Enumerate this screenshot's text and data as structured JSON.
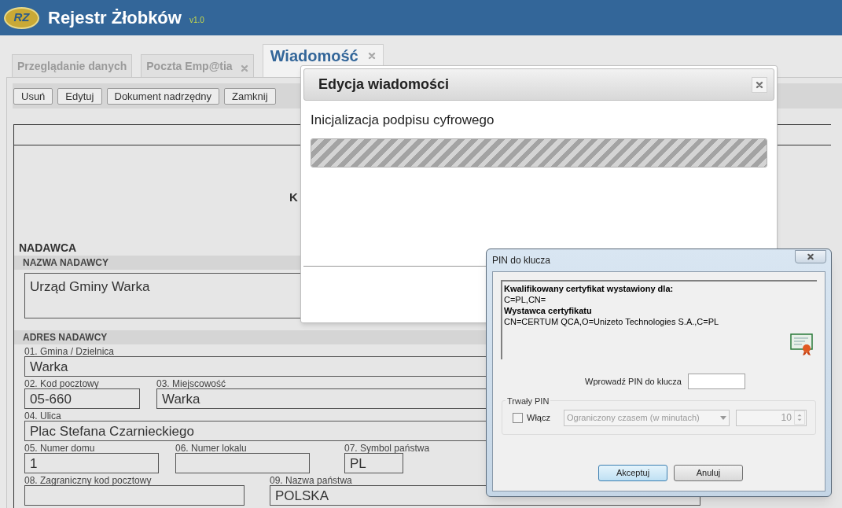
{
  "header": {
    "logo": "RZ",
    "title": "Rejestr Żłobków",
    "version": "v1.0"
  },
  "tabs": [
    {
      "label": "Przeglądanie danych",
      "closable": false,
      "selected": false
    },
    {
      "label": "Poczta Emp@tia",
      "closable": true,
      "selected": false
    },
    {
      "label": "Wiadomość",
      "closable": true,
      "selected": true
    }
  ],
  "toolbar": [
    "Usuń",
    "Edytuj",
    "Dokument nadrzędny",
    "Zamknij"
  ],
  "form": {
    "heading_fragment": "K",
    "section": "NADAWCA",
    "name_label": "NAZWA NADAWCY",
    "name_value": "Urząd Gminy Warka",
    "address_label": "ADRES NADAWCY",
    "address_rows": [
      [
        {
          "label": "01. Gmina / Dzielnica",
          "value": "Warka"
        }
      ],
      [
        {
          "label": "02. Kod pocztowy",
          "value": "05-660"
        },
        {
          "label": "03. Miejscowość",
          "value": "Warka"
        }
      ],
      [
        {
          "label": "04. Ulica",
          "value": "Plac Stefana Czarnieckiego"
        }
      ],
      [
        {
          "label": "05. Numer domu",
          "value": "1"
        },
        {
          "label": "06. Numer lokalu"
        },
        {
          "label": "07. Symbol państwa",
          "value": "PL"
        }
      ],
      [
        {
          "label": "08. Zagraniczny kod pocztowy"
        },
        {
          "label": "09. Nazwa państwa",
          "value": "POLSKA"
        }
      ]
    ]
  },
  "edit_dialog": {
    "title": "Edycja wiadomości",
    "message": "Inicjalizacja podpisu cyfrowego",
    "level": 1
  },
  "pin_dialog": {
    "title": "PIN do klucza",
    "cert_lines": [
      {
        "text": "Kwalifikowany certyfikat wystawiony dla:",
        "bold": true
      },
      {
        "text": "C=PL,CN=",
        "bold": false
      },
      {
        "text": "Wystawca certyfikatu",
        "bold": true
      },
      {
        "text": "CN=CERTUM QCA,O=Unizeto Technologies S.A.,C=PL",
        "bold": false
      }
    ],
    "pin_label": "Wprowadź PIN do klucza",
    "group_title": "Trwały PIN",
    "checkbox": {
      "label": "Włącz",
      "checked": false
    },
    "select": {
      "value": "Ograniczony czasem (w minutach)",
      "disabled": true
    },
    "spinner": {
      "value": "10",
      "disabled": true
    },
    "buttons": [
      {
        "label": "Akceptuj",
        "default": true
      },
      {
        "label": "Anuluj",
        "default": false
      }
    ]
  }
}
